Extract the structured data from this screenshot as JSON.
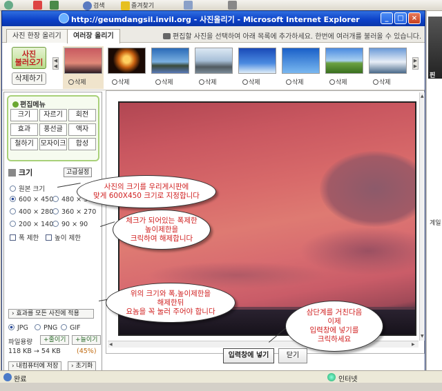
{
  "browser": {
    "toolbar_items": [
      "검색",
      "즐겨찾기"
    ]
  },
  "window": {
    "title": "http://geumdangsil.invil.org - 사진올리기 - Microsoft Internet Explorer",
    "min": "_",
    "max": "□",
    "close": "×"
  },
  "tabs": [
    {
      "label": "사진 한장 올리기",
      "active": false
    },
    {
      "label": "여러장 올리기",
      "active": true
    }
  ],
  "tab_hint": "편집할 사진을 선택하여 아래 목록에 추가하세요. 한번에 여러개를 불러올 수 있습니다.",
  "thumbs_panel": {
    "load_button": "사진\n불러오기",
    "delete_button": "삭제하기",
    "delete_label": "삭제",
    "thumbnails": [
      {
        "icon": "sunset-thumbnail"
      },
      {
        "icon": "fire-thumbnail"
      },
      {
        "icon": "coast-thumbnail"
      },
      {
        "icon": "rocks-thumbnail"
      },
      {
        "icon": "sky-thumbnail"
      },
      {
        "icon": "plane-sky-thumbnail"
      },
      {
        "icon": "field-thumbnail"
      },
      {
        "icon": "clouds-thumbnail"
      }
    ]
  },
  "edit_menu": {
    "title": "편집메뉴",
    "buttons": [
      "크기",
      "자르기",
      "회전",
      "효과",
      "풍선글",
      "액자",
      "철하기",
      "모자이크",
      "합성"
    ]
  },
  "size_panel": {
    "title": "크기",
    "advanced": "고급설정",
    "original": "원본 크기",
    "options": [
      "600 × 450",
      "480 × 360",
      "400 × 280",
      "360 × 270",
      "200 × 140",
      "90 × 90"
    ],
    "selected": "600 × 450",
    "width_limit": "폭 제한",
    "height_limit": "높이 제한",
    "apply_all": "효과를 모든 사진에 적용",
    "formats": [
      "JPG",
      "PNG",
      "GIF"
    ],
    "selected_format": "JPG",
    "file_size_label": "파일용량",
    "shrink_button": "줄이기",
    "grow_button": "늘이기",
    "size_info": "118 KB → 54 KB",
    "size_percent": "(45%)",
    "save_button": "내컴퓨터에 저장",
    "reset_button": "초기화"
  },
  "main": {
    "insert_button": "입력창에 넣기",
    "close_button": "닫기"
  },
  "callouts": {
    "c1": "사진의 크기를 우리게시판에\n맞게 600X450 크기로 지정합니다",
    "c2": "체크가 되어있는 폭제한\n높이제한을\n크릭하여 해제합니다",
    "c3": "위의 크기와 폭,높이제한을\n해제한뒤\n요놈을 꼭 눌러 주어야 합니다",
    "c4": "삼단계를 거친다음\n이제\n입력창에 넣기를\n크릭하세요"
  },
  "status": {
    "left": "완료",
    "right": "인터넷"
  },
  "background_strip": {
    "text1": "핀",
    "text2": "계일"
  },
  "colors": {
    "title_bar": "#0b3fc7",
    "callout_text": "#d02020",
    "menu_border": "#a8d078"
  }
}
